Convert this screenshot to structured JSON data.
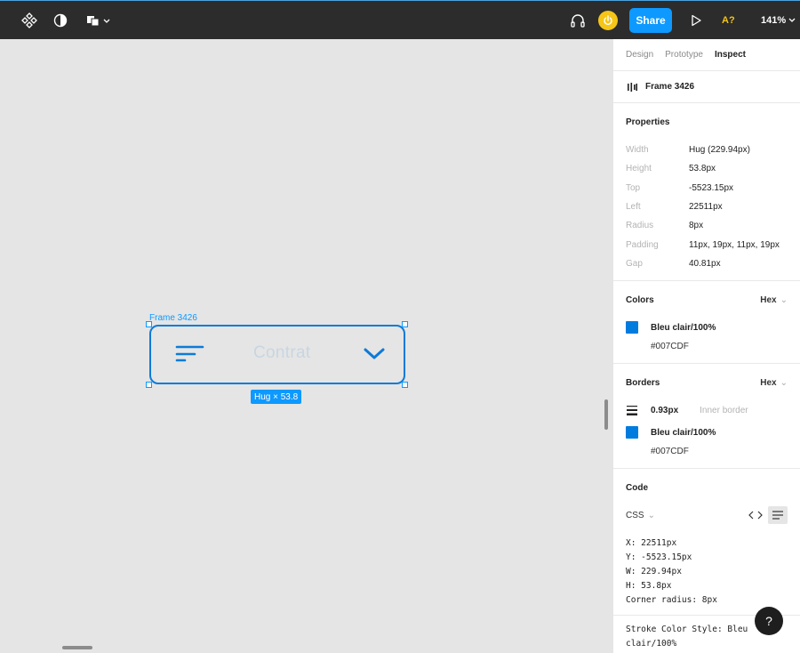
{
  "topbar": {
    "share_label": "Share",
    "account_label": "A?",
    "zoom": "141%"
  },
  "canvas": {
    "frame_label": "Frame 3426",
    "frame_text": "Contrat",
    "hug_badge": "Hug × 53.8"
  },
  "panel": {
    "tabs": [
      "Design",
      "Prototype",
      "Inspect"
    ],
    "frame_name": "Frame 3426",
    "properties_title": "Properties",
    "properties": [
      {
        "label": "Width",
        "value": "Hug (229.94px)"
      },
      {
        "label": "Height",
        "value": "53.8px"
      },
      {
        "label": "Top",
        "value": "-5523.15px"
      },
      {
        "label": "Left",
        "value": "22511px"
      },
      {
        "label": "Radius",
        "value": "8px"
      },
      {
        "label": "Padding",
        "value": "11px, 19px, 11px, 19px"
      },
      {
        "label": "Gap",
        "value": "40.81px"
      }
    ],
    "colors_title": "Colors",
    "colors_format": "Hex",
    "color_name": "Bleu clair/100%",
    "color_hex": "#007CDF",
    "borders_title": "Borders",
    "borders_format": "Hex",
    "border_width": "0.93px",
    "border_type": "Inner border",
    "border_color_name": "Bleu clair/100%",
    "border_color_hex": "#007CDF",
    "code_title": "Code",
    "code_lang": "CSS",
    "code_lines": [
      "X: 22511px",
      "Y: -5523.15px",
      "W: 229.94px",
      "H: 53.8px",
      "Corner radius: 8px"
    ],
    "code_extra_1": "Stroke Color Style: Bleu",
    "code_extra_2": "clair/100%"
  },
  "help_label": "?"
}
